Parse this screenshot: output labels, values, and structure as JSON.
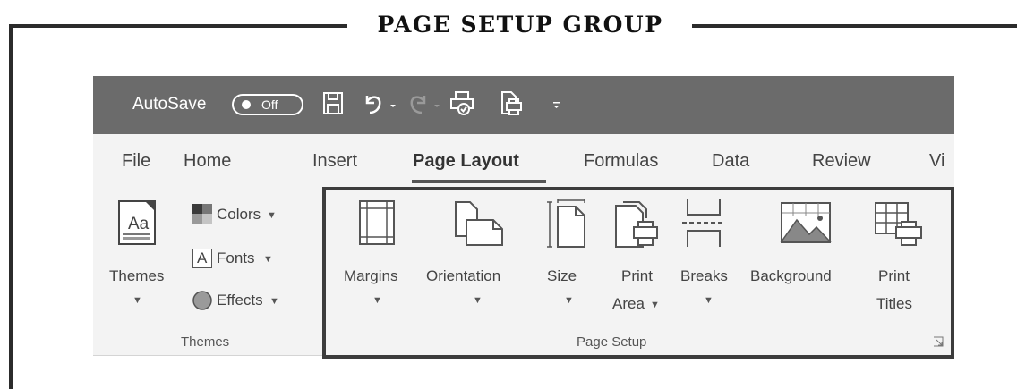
{
  "figure": {
    "title": "PAGE SETUP GROUP"
  },
  "quick_access": {
    "autosave_label": "AutoSave",
    "autosave_state": "Off",
    "icons": [
      "save-icon",
      "undo-icon",
      "redo-icon",
      "print-preview-icon",
      "print-icon",
      "customize-icon"
    ]
  },
  "tabs": [
    {
      "label": "File"
    },
    {
      "label": "Home"
    },
    {
      "label": "Insert"
    },
    {
      "label": "Page Layout",
      "active": true
    },
    {
      "label": "Formulas"
    },
    {
      "label": "Data"
    },
    {
      "label": "Review"
    },
    {
      "label": "Vi"
    }
  ],
  "themes_group": {
    "themes_button": "Themes",
    "colors_button": "Colors",
    "fonts_button": "Fonts",
    "effects_button": "Effects",
    "group_label": "Themes",
    "themes_icon_text": "Aa",
    "fonts_icon_text": "A"
  },
  "page_setup_group": {
    "margins": "Margins",
    "orientation": "Orientation",
    "size": "Size",
    "print_area_line1": "Print",
    "print_area_line2": "Area",
    "breaks": "Breaks",
    "background": "Background",
    "print_titles_line1": "Print",
    "print_titles_line2": "Titles",
    "group_label": "Page Setup"
  },
  "colors": {
    "titlebar": "#6b6b6b",
    "ribbon": "#f3f3f3",
    "highlight": "#3c3c3c"
  }
}
